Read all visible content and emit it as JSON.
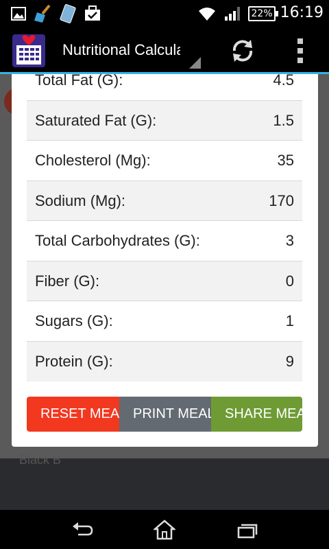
{
  "status_bar": {
    "time": "16:19",
    "battery_percent": "22%",
    "icons": [
      "gallery-icon",
      "cleaner-icon",
      "sim-card-icon",
      "briefcase-check-icon",
      "wifi-icon",
      "signal-icon",
      "battery-icon"
    ]
  },
  "action_bar": {
    "title": "Nutritional Calculator",
    "icons": [
      "app-logo-icon",
      "refresh-icon",
      "overflow-menu-icon"
    ]
  },
  "background": {
    "partial_text": "Black B"
  },
  "nutrition": {
    "rows": [
      {
        "label": "Total Fat (G):",
        "value": "4.5"
      },
      {
        "label": "Saturated Fat (G):",
        "value": "1.5"
      },
      {
        "label": "Cholesterol (Mg):",
        "value": "35"
      },
      {
        "label": "Sodium (Mg):",
        "value": "170"
      },
      {
        "label": "Total Carbohydrates (G):",
        "value": "3"
      },
      {
        "label": "Fiber (G):",
        "value": "0"
      },
      {
        "label": "Sugars (G):",
        "value": "1"
      },
      {
        "label": "Protein (G):",
        "value": "9"
      }
    ]
  },
  "buttons": {
    "reset": "RESET MEAL",
    "print": "PRINT MEAL",
    "share": "SHARE MEAL",
    "colors": {
      "reset": "#f2381f",
      "print": "#636a72",
      "share": "#6f9b35"
    }
  },
  "nav_bar": {
    "icons": [
      "back-icon",
      "home-icon",
      "recent-apps-icon"
    ]
  }
}
